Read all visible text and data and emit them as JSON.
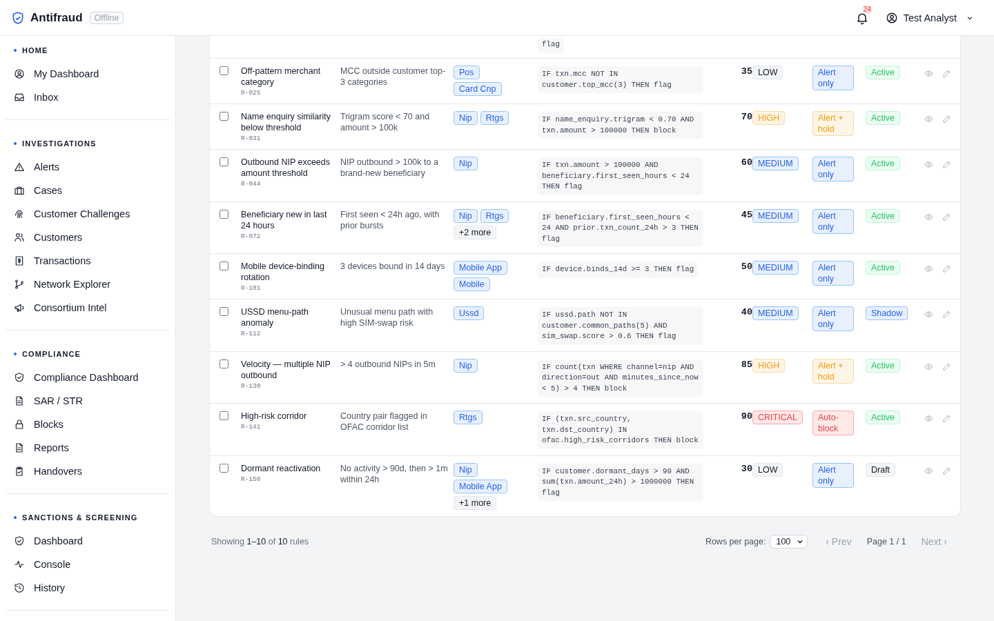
{
  "header": {
    "app_name": "Antifraud",
    "connection": "Offline",
    "notifications": "24",
    "user": "Test Analyst"
  },
  "sidebar": [
    {
      "title": "HOME",
      "items": [
        "My Dashboard",
        "Inbox"
      ]
    },
    {
      "title": "INVESTIGATIONS",
      "items": [
        "Alerts",
        "Cases",
        "Customer Challenges",
        "Customers",
        "Transactions",
        "Network Explorer",
        "Consortium Intel"
      ]
    },
    {
      "title": "COMPLIANCE",
      "items": [
        "Compliance Dashboard",
        "SAR / STR",
        "Blocks",
        "Reports",
        "Handovers"
      ]
    },
    {
      "title": "SANCTIONS & SCREENING",
      "items": [
        "Dashboard",
        "Console",
        "History"
      ]
    }
  ],
  "partial_row": {
    "code": "flag"
  },
  "rules": [
    {
      "checked": false,
      "name": "Off-pattern merchant category",
      "id": "R-025",
      "description": "MCC outside customer top-3 categories",
      "tags": [
        "Pos",
        "Card Cnp"
      ],
      "code": "IF txn.mcc NOT IN customer.top_mcc(3) THEN flag",
      "score": "35",
      "severity": {
        "label": "LOW",
        "kind": "low"
      },
      "action": {
        "label": "Alert only",
        "kind": "alert"
      },
      "status": {
        "label": "Active",
        "kind": "active"
      }
    },
    {
      "checked": false,
      "name": "Name enquiry similarity below threshold",
      "id": "R-031",
      "description": "Trigram score < 70 and amount > 100k",
      "tags": [
        "Nip",
        "Rtgs"
      ],
      "code": "IF name_enquiry.trigram < 0.70 AND txn.amount > 100000 THEN block",
      "score": "70",
      "severity": {
        "label": "HIGH",
        "kind": "high"
      },
      "action": {
        "label": "Alert + hold",
        "kind": "hold"
      },
      "status": {
        "label": "Active",
        "kind": "active"
      }
    },
    {
      "checked": false,
      "name": "Outbound NIP exceeds amount threshold",
      "id": "R-044",
      "description": "NIP outbound > 100k to a brand-new beneficiary",
      "tags": [
        "Nip"
      ],
      "code": "IF txn.amount > 100000 AND beneficiary.first_seen_hours < 24 THEN flag",
      "score": "60",
      "severity": {
        "label": "MEDIUM",
        "kind": "medium"
      },
      "action": {
        "label": "Alert only",
        "kind": "alert"
      },
      "status": {
        "label": "Active",
        "kind": "active"
      }
    },
    {
      "checked": false,
      "name": "Beneficiary new in last 24 hours",
      "id": "R-072",
      "description": "First seen < 24h ago, with prior bursts",
      "tags": [
        "Nip",
        "Rtgs"
      ],
      "more": "+2 more",
      "code": "IF beneficiary.first_seen_hours < 24 AND prior.txn_count_24h > 3 THEN flag",
      "score": "45",
      "severity": {
        "label": "MEDIUM",
        "kind": "medium"
      },
      "action": {
        "label": "Alert only",
        "kind": "alert"
      },
      "status": {
        "label": "Active",
        "kind": "active"
      }
    },
    {
      "checked": false,
      "name": "Mobile device-binding rotation",
      "id": "R-101",
      "description": "3 devices bound in 14 days",
      "tags": [
        "Mobile App",
        "Mobile"
      ],
      "code": "IF device.binds_14d >= 3 THEN flag",
      "score": "50",
      "severity": {
        "label": "MEDIUM",
        "kind": "medium"
      },
      "action": {
        "label": "Alert only",
        "kind": "alert"
      },
      "status": {
        "label": "Active",
        "kind": "active"
      }
    },
    {
      "checked": false,
      "name": "USSD menu-path anomaly",
      "id": "R-112",
      "description": "Unusual menu path with high SIM-swap risk",
      "tags": [
        "Ussd"
      ],
      "code": "IF ussd.path NOT IN customer.common_paths(5) AND sim_swap.score > 0.6 THEN flag",
      "score": "40",
      "severity": {
        "label": "MEDIUM",
        "kind": "medium"
      },
      "action": {
        "label": "Alert only",
        "kind": "alert"
      },
      "status": {
        "label": "Shadow",
        "kind": "shadow"
      }
    },
    {
      "checked": false,
      "name": "Velocity — multiple NIP outbound",
      "id": "R-130",
      "description": "> 4 outbound NIPs in 5m",
      "tags": [
        "Nip"
      ],
      "code": "IF count(txn WHERE channel=nip AND direction=out AND minutes_since_now < 5) > 4 THEN block",
      "score": "85",
      "severity": {
        "label": "HIGH",
        "kind": "high"
      },
      "action": {
        "label": "Alert + hold",
        "kind": "hold"
      },
      "status": {
        "label": "Active",
        "kind": "active"
      }
    },
    {
      "checked": false,
      "name": "High-risk corridor",
      "id": "R-141",
      "description": "Country pair flagged in OFAC corridor list",
      "tags": [
        "Rtgs"
      ],
      "code": "IF (txn.src_country, txn.dst_country) IN ofac.high_risk_corridors THEN block",
      "score": "90",
      "severity": {
        "label": "CRITICAL",
        "kind": "critical"
      },
      "action": {
        "label": "Auto-block",
        "kind": "block"
      },
      "status": {
        "label": "Active",
        "kind": "active"
      }
    },
    {
      "checked": false,
      "name": "Dormant reactivation",
      "id": "R-150",
      "description": "No activity > 90d, then > 1m within 24h",
      "tags": [
        "Nip",
        "Mobile App"
      ],
      "more": "+1 more",
      "code": "IF customer.dormant_days > 90 AND sum(txn.amount_24h) > 1000000 THEN flag",
      "score": "30",
      "severity": {
        "label": "LOW",
        "kind": "low"
      },
      "action": {
        "label": "Alert only",
        "kind": "alert"
      },
      "status": {
        "label": "Draft",
        "kind": "draft"
      }
    }
  ],
  "footer": {
    "summary": "Showing **1–10** of **10** rules",
    "rows_label": "Rows per page:",
    "rows_value": "100",
    "prev": {
      "label": "‹ Prev",
      "disabled": true
    },
    "page": "Page 1 / 1",
    "next": {
      "label": "Next ›",
      "disabled": true
    }
  }
}
